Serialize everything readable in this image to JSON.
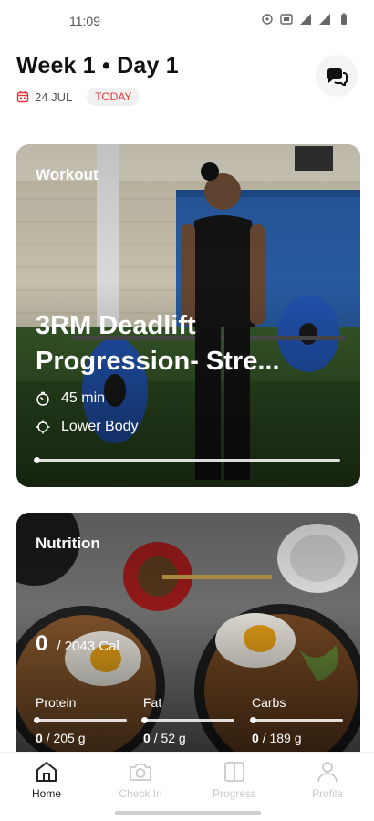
{
  "status_bar": {
    "time": "11:09"
  },
  "header": {
    "title": "Week 1 • Day 1",
    "date": "24 JUL",
    "today_badge": "TODAY"
  },
  "workout_card": {
    "label": "Workout",
    "title": "3RM Deadlift Progression- Stre...",
    "duration": "45 min",
    "focus": "Lower Body",
    "progress": 0
  },
  "nutrition_card": {
    "label": "Nutrition",
    "calories_current": "0",
    "calories_total": "/ 2043 Cal",
    "macros": [
      {
        "label": "Protein",
        "current": "0",
        "total": "/ 205 g"
      },
      {
        "label": "Fat",
        "current": "0",
        "total": "/ 52 g"
      },
      {
        "label": "Carbs",
        "current": "0",
        "total": "/ 189 g"
      }
    ]
  },
  "bottom_nav": [
    {
      "label": "Home",
      "icon": "home-icon",
      "active": true
    },
    {
      "label": "Check In",
      "icon": "camera-icon",
      "active": false
    },
    {
      "label": "Progress",
      "icon": "book-icon",
      "active": false
    },
    {
      "label": "Profile",
      "icon": "person-icon",
      "active": false
    }
  ],
  "colors": {
    "accent": "#e23b3b",
    "nav_inactive": "#c9c9c9"
  }
}
